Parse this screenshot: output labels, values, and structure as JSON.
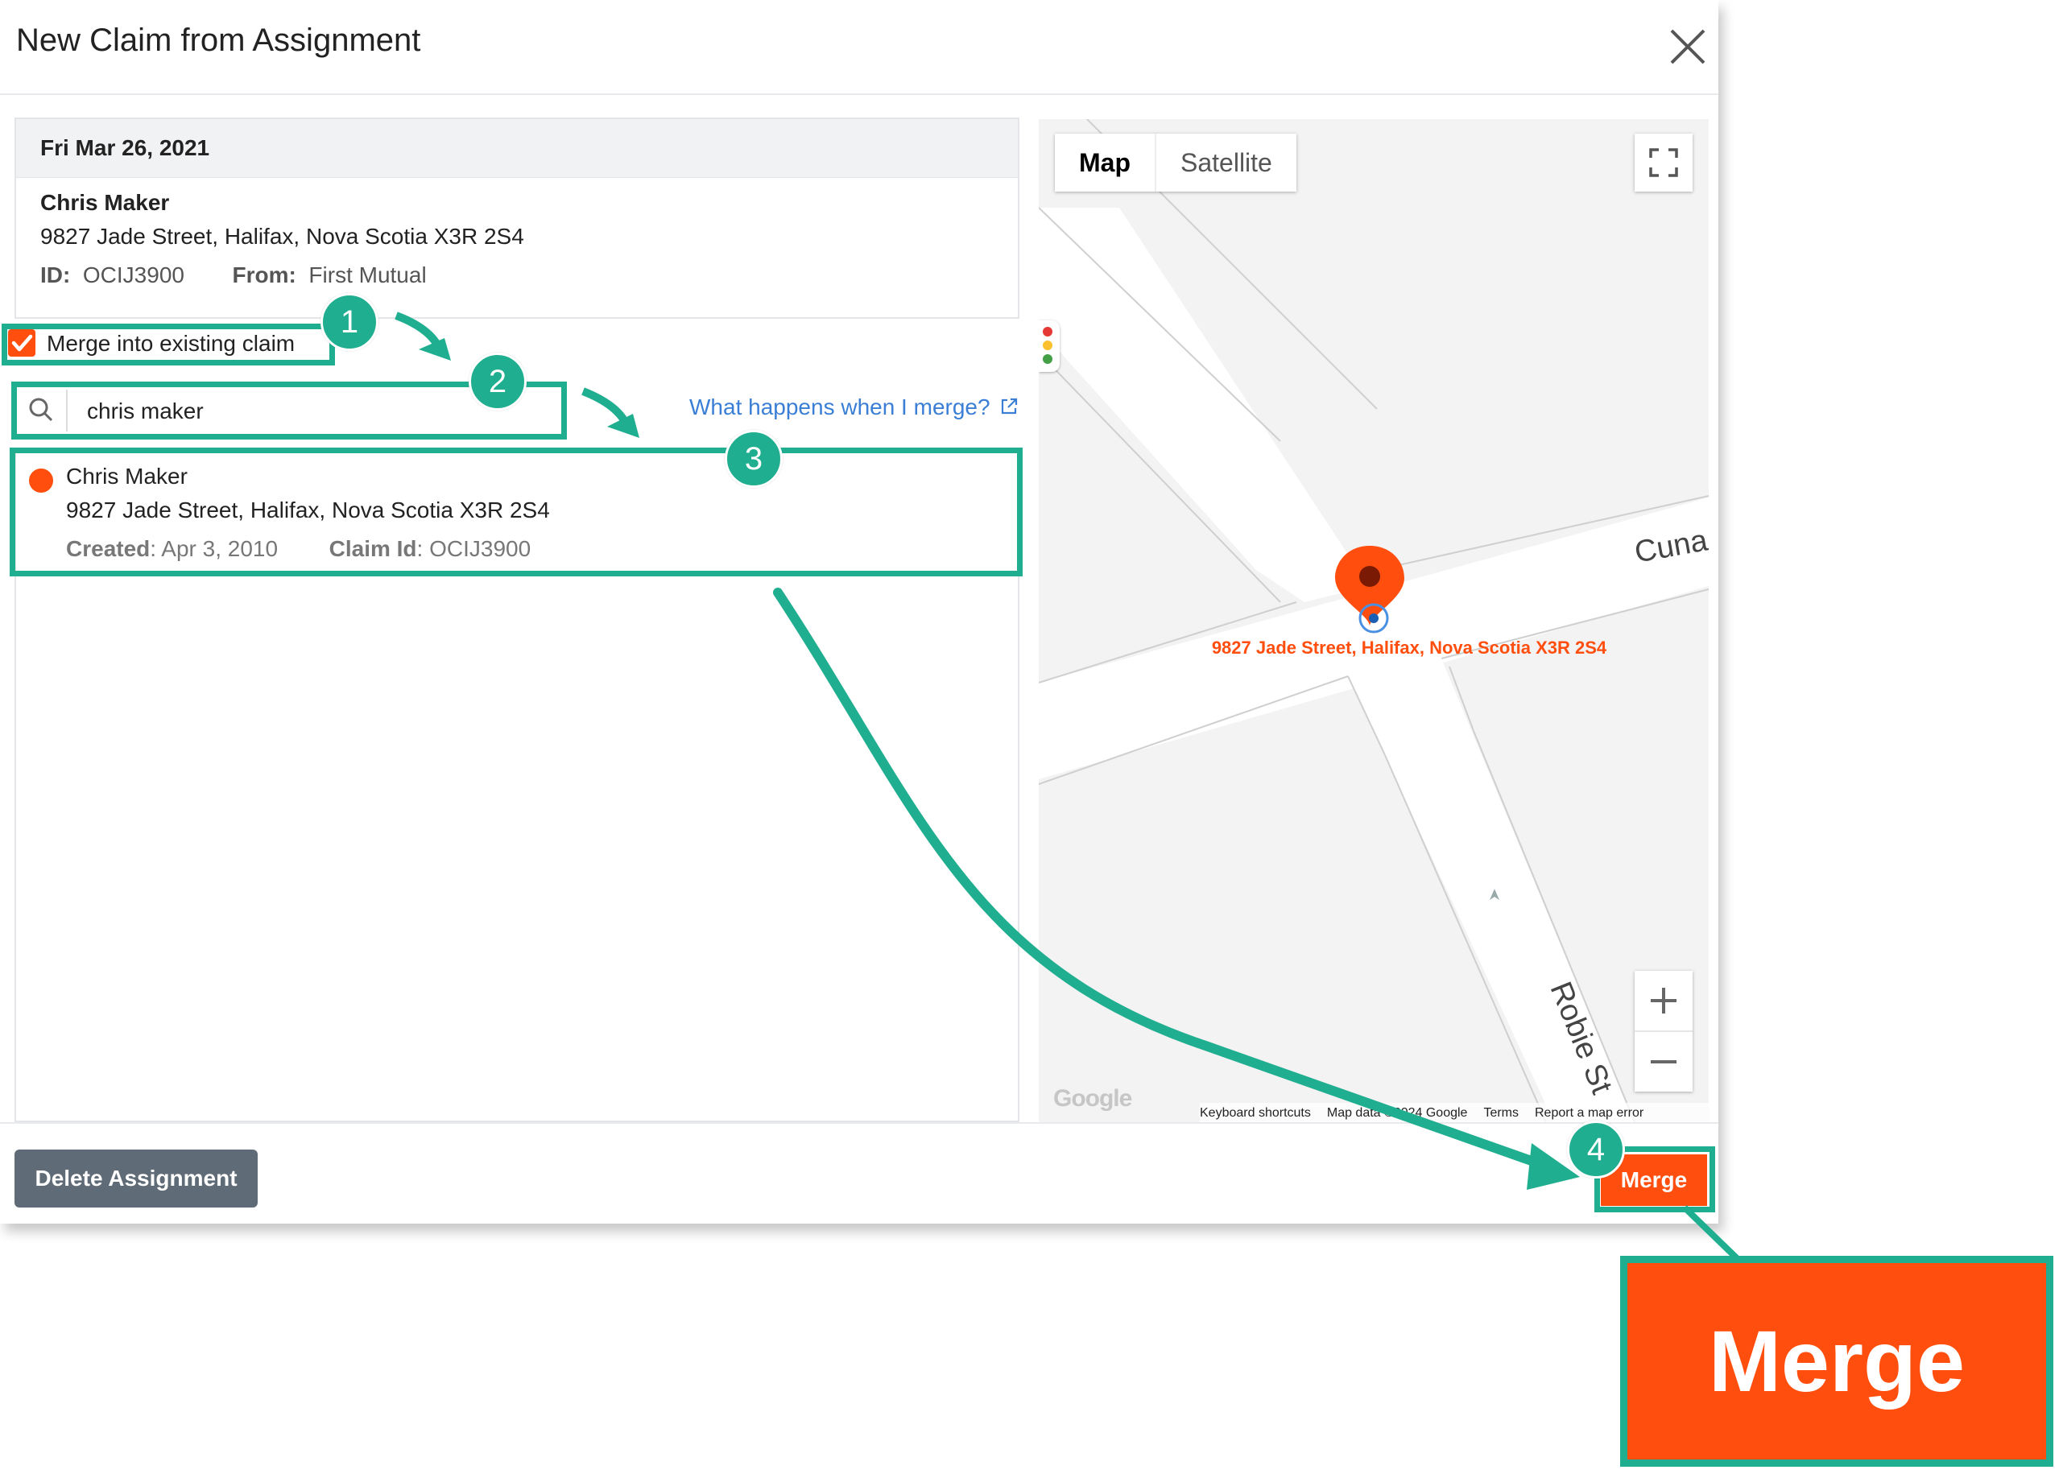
{
  "modal": {
    "title": "New Claim from Assignment"
  },
  "assignment": {
    "date": "Fri Mar 26, 2021",
    "name": "Chris Maker",
    "address": "9827 Jade Street, Halifax, Nova Scotia X3R 2S4",
    "id_label": "ID:",
    "id_value": "OCIJ3900",
    "from_label": "From:",
    "from_value": "First Mutual"
  },
  "merge_option": {
    "label": "Merge into existing claim",
    "checked": true
  },
  "search": {
    "value": "chris maker",
    "placeholder": ""
  },
  "help_link": {
    "label": "What happens when I merge?"
  },
  "results": [
    {
      "name": "Chris Maker",
      "address": "9827 Jade Street, Halifax, Nova Scotia X3R 2S4",
      "created_label": "Created",
      "created_value": ": Apr 3, 2010",
      "claim_id_label": "Claim Id",
      "claim_id_value": ": OCIJ3900",
      "status_color": "#ff4e0e"
    }
  ],
  "map": {
    "tabs": [
      "Map",
      "Satellite"
    ],
    "active_tab": "Map",
    "pin_label": "9827 Jade Street, Halifax, Nova Scotia X3R 2S4",
    "street_1": "Cuna",
    "street_2": "Robie St",
    "logo": "Google",
    "attribution": [
      "Keyboard shortcuts",
      "Map data ©2024 Google",
      "Terms",
      "Report a map error"
    ],
    "icons": [
      "fullscreen-icon",
      "traffic-light-icon",
      "zoom-in-icon",
      "zoom-out-icon",
      "map-pin-icon"
    ]
  },
  "footer": {
    "delete_label": "Delete Assignment",
    "merge_label": "Merge"
  },
  "annotations": {
    "steps": [
      "1",
      "2",
      "3",
      "4"
    ],
    "zoomed_label": "Merge",
    "color": "#1fae8f"
  },
  "colors": {
    "accent": "#ff4e0e",
    "link": "#3a7fd5",
    "secondary_button": "#606b78"
  }
}
